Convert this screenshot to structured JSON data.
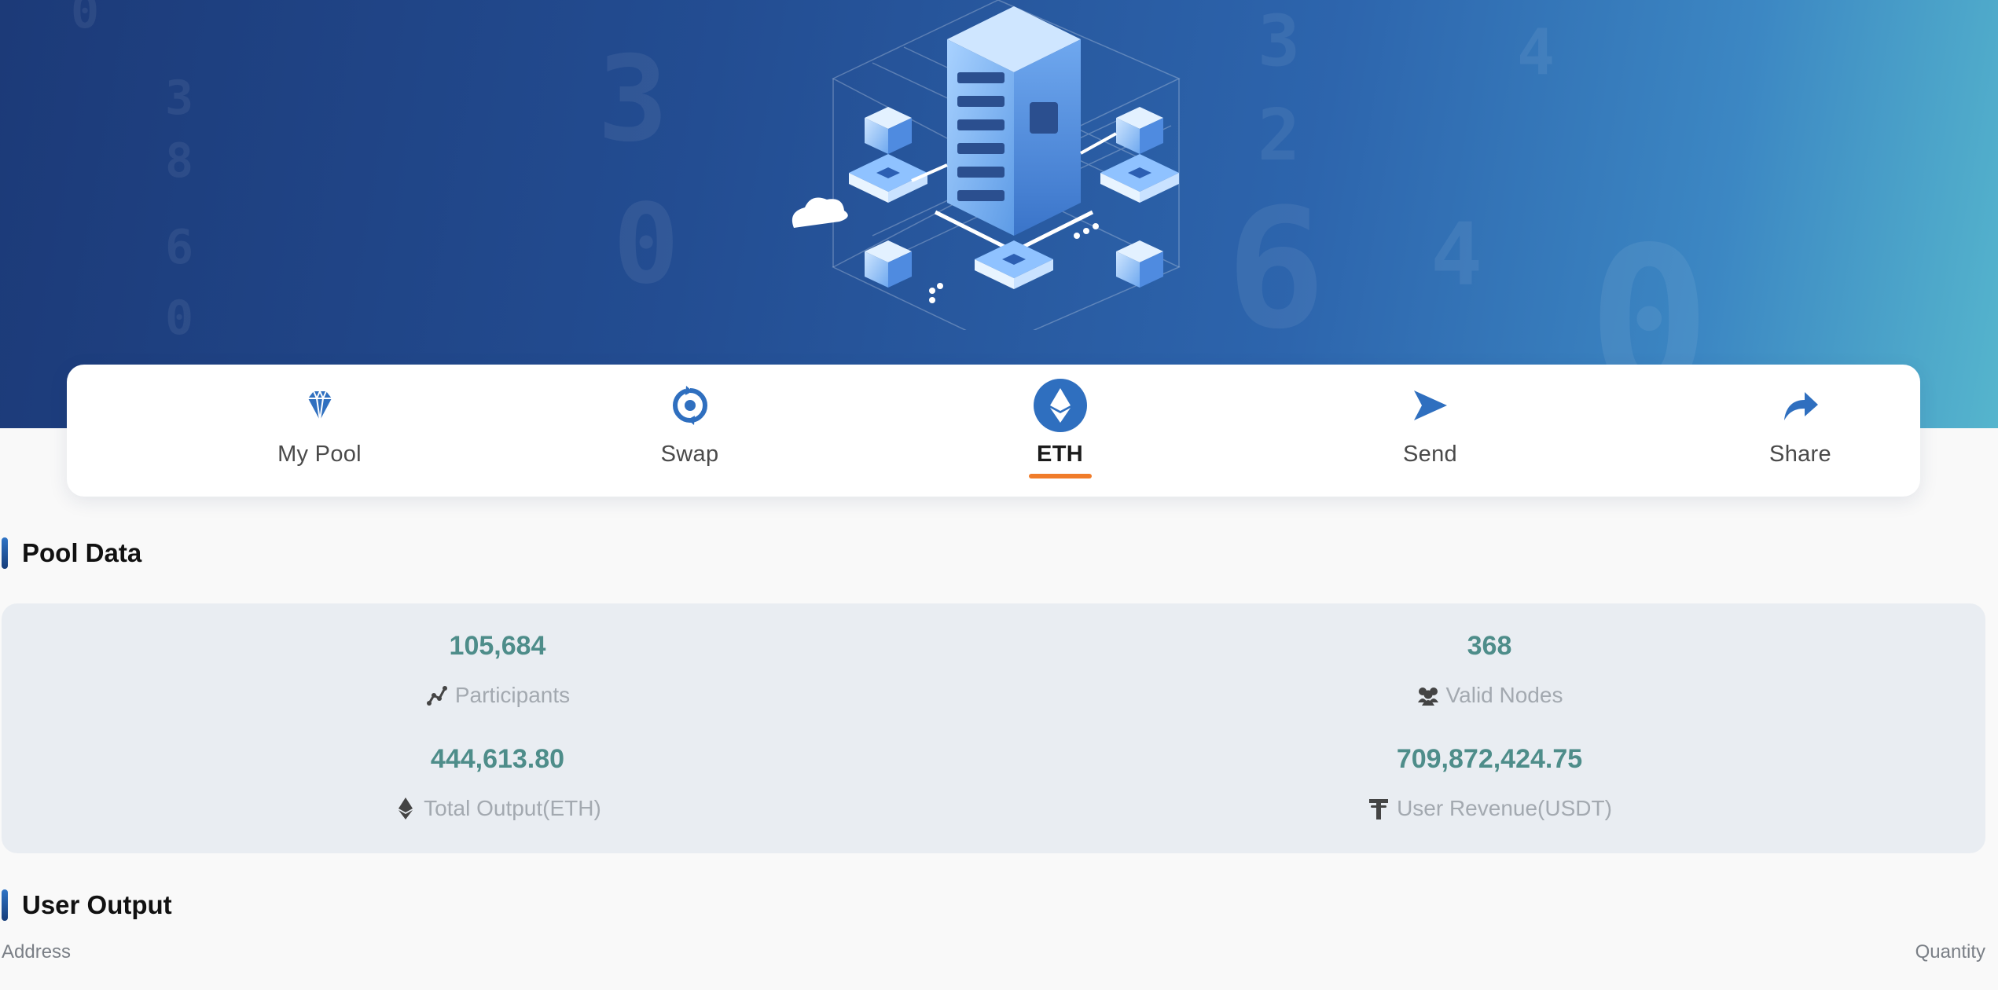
{
  "nav": {
    "items": [
      {
        "label": "My Pool",
        "icon": "diamond-icon"
      },
      {
        "label": "Swap",
        "icon": "swap-cycle-icon"
      },
      {
        "label": "ETH",
        "icon": "ethereum-icon",
        "active": true
      },
      {
        "label": "Send",
        "icon": "send-arrow-icon"
      },
      {
        "label": "Share",
        "icon": "share-arrow-icon"
      }
    ]
  },
  "pool_data": {
    "title": "Pool Data",
    "stats": [
      {
        "value": "105,684",
        "label": "Participants",
        "icon": "chart-line-icon"
      },
      {
        "value": "368",
        "label": "Valid Nodes",
        "icon": "users-icon"
      },
      {
        "value": "444,613.80",
        "label": "Total Output(ETH)",
        "icon": "ethereum-icon"
      },
      {
        "value": "709,872,424.75",
        "label": "User Revenue(USDT)",
        "icon": "tether-icon"
      }
    ]
  },
  "user_output": {
    "title": "User Output",
    "columns": {
      "address": "Address",
      "quantity": "Quantity"
    }
  },
  "colors": {
    "accent": "#2f6fbf",
    "active_underline": "#f07c2a",
    "stat_value": "#4e8d8a",
    "stat_label": "#a3a9b0"
  }
}
